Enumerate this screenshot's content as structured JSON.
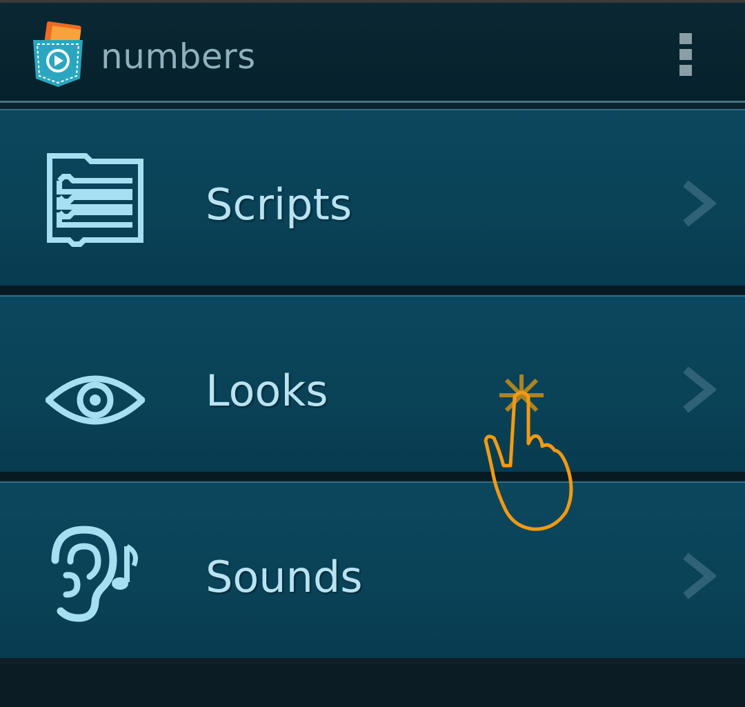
{
  "action_bar": {
    "title": "numbers",
    "app_icon": "pocket-code-icon",
    "menu_icon": "overflow-menu-icon"
  },
  "menu": {
    "items": [
      {
        "label": "Scripts",
        "icon": "scripts-icon"
      },
      {
        "label": "Looks",
        "icon": "eye-icon"
      },
      {
        "label": "Sounds",
        "icon": "ear-music-icon"
      }
    ]
  },
  "colors": {
    "item_bg": "#0a4257",
    "label": "#b9e3f2",
    "icon": "#a6def2",
    "touch": "#f39a12"
  }
}
